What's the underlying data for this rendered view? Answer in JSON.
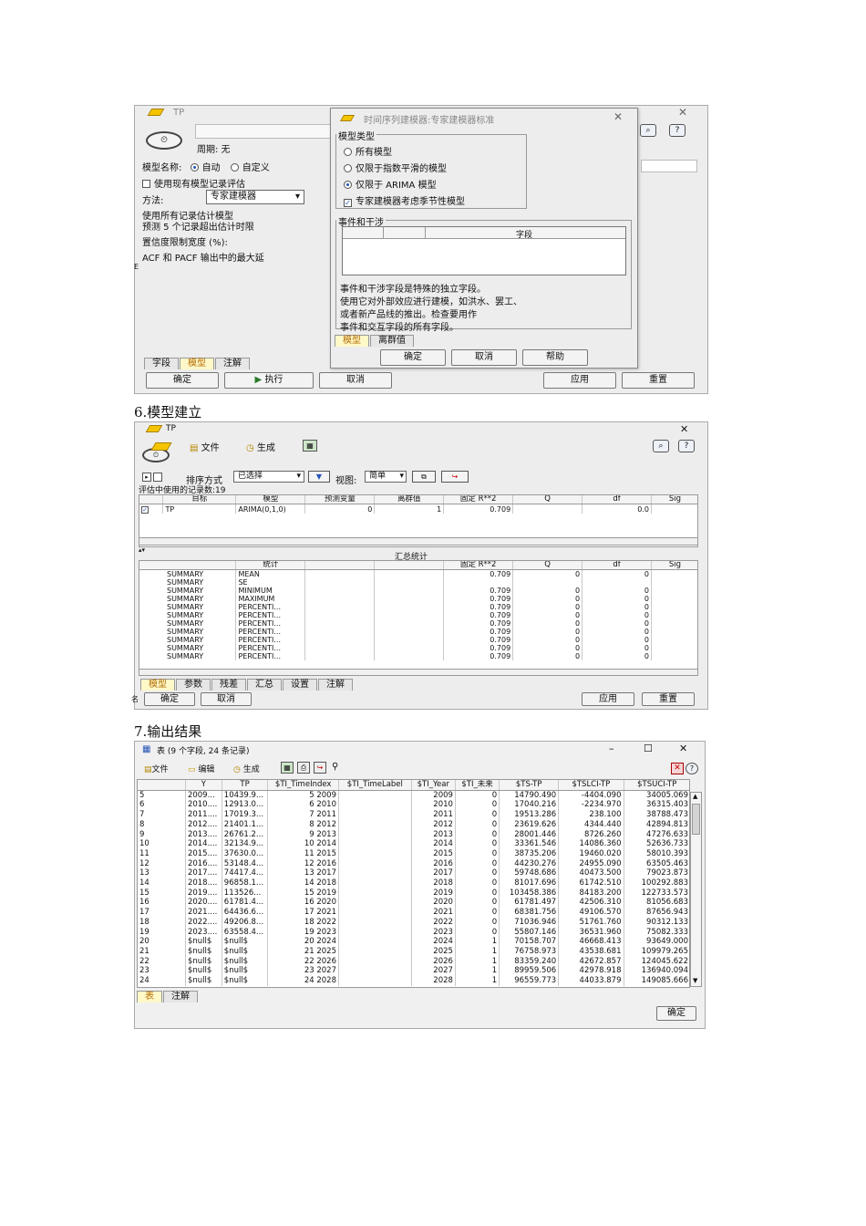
{
  "s1": {
    "title": "TP",
    "period": "周期: 无",
    "model_name_label": "模型名称:",
    "auto": "自动",
    "custom": "自定义",
    "use_existing": "使用现有模型记录评估",
    "method_label": "方法:",
    "method_value": "专家建模器",
    "line1": "使用所有记录估计模型",
    "line2": "预测 5 个记录超出估计时限",
    "line3": "置信度限制宽度 (%):",
    "line4": "ACF 和 PACF 输出中的最大延",
    "tabs": [
      "字段",
      "模型",
      "注解"
    ],
    "ok": "确定",
    "run": "执行",
    "cancel": "取消",
    "apply": "应用",
    "reset": "重置",
    "gutter": "E",
    "dialog": {
      "title": "时间序列建模器:专家建模器标准",
      "group": "模型类型",
      "opt1": "所有模型",
      "opt2": "仅限于指数平滑的模型",
      "opt3": "仅限于 ARIMA 模型",
      "season": "专家建模器考虑季节性模型",
      "events_group": "事件和干涉",
      "field_col": "字段",
      "desc1": "事件和干涉字段是特殊的独立字段。",
      "desc2": "使用它对外部效应进行建模，如洪水、罢工、",
      "desc3": "或者新产品线的推出。检查要用作",
      "desc4": "事件和交互字段的所有字段。",
      "tab_model": "模型",
      "tab_outlier": "离群值",
      "ok": "确定",
      "cancel": "取消",
      "help": "帮助"
    }
  },
  "cap1": "6.模型建立",
  "s2": {
    "title": "TP",
    "file": "文件",
    "generate": "生成",
    "sort_label": "排序方式",
    "sort_value": "已选择",
    "view_label": "视图:",
    "view_value": "简单",
    "records": "评估中使用的记录数:19",
    "headers": [
      "目标",
      "模型",
      "预测变量",
      "离群值",
      "固定 R**2",
      "Q",
      "df",
      "Sig"
    ],
    "row": [
      "TP",
      "ARIMA(0,1,0)",
      "0",
      "1",
      "0.709",
      "",
      "0.0",
      ""
    ],
    "summary_title": "汇总统计",
    "s_headers": [
      "",
      "统计",
      "",
      "",
      "固定 R**2",
      "Q",
      "df",
      "Sig"
    ],
    "s_rows": [
      [
        "SUMMARY",
        "MEAN",
        "0.709",
        "0",
        "0"
      ],
      [
        "SUMMARY",
        "SE",
        "",
        "",
        ""
      ],
      [
        "SUMMARY",
        "MINIMUM",
        "0.709",
        "0",
        "0"
      ],
      [
        "SUMMARY",
        "MAXIMUM",
        "0.709",
        "0",
        "0"
      ],
      [
        "SUMMARY",
        "PERCENTI...",
        "0.709",
        "0",
        "0"
      ],
      [
        "SUMMARY",
        "PERCENTI...",
        "0.709",
        "0",
        "0"
      ],
      [
        "SUMMARY",
        "PERCENTI...",
        "0.709",
        "0",
        "0"
      ],
      [
        "SUMMARY",
        "PERCENTI...",
        "0.709",
        "0",
        "0"
      ],
      [
        "SUMMARY",
        "PERCENTI...",
        "0.709",
        "0",
        "0"
      ],
      [
        "SUMMARY",
        "PERCENTI...",
        "0.709",
        "0",
        "0"
      ],
      [
        "SUMMARY",
        "PERCENTI...",
        "0.709",
        "0",
        "0"
      ]
    ],
    "tabs": [
      "模型",
      "参数",
      "残差",
      "汇总",
      "设置",
      "注解"
    ],
    "ok": "确定",
    "cancel": "取消",
    "apply": "应用",
    "reset": "重置",
    "gutter": "名"
  },
  "cap2": "7.输出结果",
  "s3": {
    "title": "表 (9 个字段, 24 条记录)",
    "file": "文件",
    "edit": "编辑",
    "generate": "生成",
    "headers": [
      "",
      "Y",
      "TP",
      "$TI_TimeIndex",
      "$TI_TimeLabel",
      "$TI_Year",
      "$TI_未来",
      "$TS-TP",
      "$TSLCI-TP",
      "$TSUCI-TP"
    ],
    "rows": [
      [
        "5",
        "2009...",
        "10439.9...",
        "5 2009",
        "2009",
        "0",
        "14790.490",
        "-4404.090",
        "34005.069"
      ],
      [
        "6",
        "2010....",
        "12913.0...",
        "6 2010",
        "2010",
        "0",
        "17040.216",
        "-2234.970",
        "36315.403"
      ],
      [
        "7",
        "2011....",
        "17019.3...",
        "7 2011",
        "2011",
        "0",
        "19513.286",
        "238.100",
        "38788.473"
      ],
      [
        "8",
        "2012....",
        "21401.1...",
        "8 2012",
        "2012",
        "0",
        "23619.626",
        "4344.440",
        "42894.813"
      ],
      [
        "9",
        "2013....",
        "26761.2...",
        "9 2013",
        "2013",
        "0",
        "28001.446",
        "8726.260",
        "47276.633"
      ],
      [
        "10",
        "2014....",
        "32134.9...",
        "10 2014",
        "2014",
        "0",
        "33361.546",
        "14086.360",
        "52636.733"
      ],
      [
        "11",
        "2015....",
        "37630.0...",
        "11 2015",
        "2015",
        "0",
        "38735.206",
        "19460.020",
        "58010.393"
      ],
      [
        "12",
        "2016....",
        "53148.4...",
        "12 2016",
        "2016",
        "0",
        "44230.276",
        "24955.090",
        "63505.463"
      ],
      [
        "13",
        "2017....",
        "74417.4...",
        "13 2017",
        "2017",
        "0",
        "59748.686",
        "40473.500",
        "79023.873"
      ],
      [
        "14",
        "2018....",
        "96858.1...",
        "14 2018",
        "2018",
        "0",
        "81017.696",
        "61742.510",
        "100292.883"
      ],
      [
        "15",
        "2019....",
        "113526...",
        "15 2019",
        "2019",
        "0",
        "103458.386",
        "84183.200",
        "122733.573"
      ],
      [
        "16",
        "2020....",
        "61781.4...",
        "16 2020",
        "2020",
        "0",
        "61781.497",
        "42506.310",
        "81056.683"
      ],
      [
        "17",
        "2021....",
        "64436.6...",
        "17 2021",
        "2021",
        "0",
        "68381.756",
        "49106.570",
        "87656.943"
      ],
      [
        "18",
        "2022....",
        "49206.8...",
        "18 2022",
        "2022",
        "0",
        "71036.946",
        "51761.760",
        "90312.133"
      ],
      [
        "19",
        "2023....",
        "63558.4...",
        "19 2023",
        "2023",
        "0",
        "55807.146",
        "36531.960",
        "75082.333"
      ],
      [
        "20",
        "$null$",
        "$null$",
        "20 2024",
        "2024",
        "1",
        "70158.707",
        "46668.413",
        "93649.000"
      ],
      [
        "21",
        "$null$",
        "$null$",
        "21 2025",
        "2025",
        "1",
        "76758.973",
        "43538.681",
        "109979.265"
      ],
      [
        "22",
        "$null$",
        "$null$",
        "22 2026",
        "2026",
        "1",
        "83359.240",
        "42672.857",
        "124045.622"
      ],
      [
        "23",
        "$null$",
        "$null$",
        "23 2027",
        "2027",
        "1",
        "89959.506",
        "42978.918",
        "136940.094"
      ],
      [
        "24",
        "$null$",
        "$null$",
        "24 2028",
        "2028",
        "1",
        "96559.773",
        "44033.879",
        "149085.666"
      ]
    ],
    "tabs": [
      "表",
      "注解"
    ],
    "ok": "确定"
  }
}
